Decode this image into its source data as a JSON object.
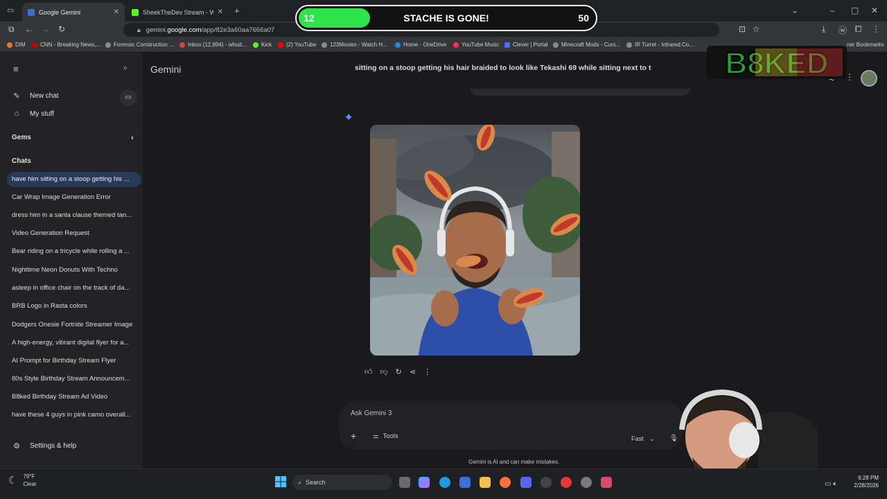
{
  "browser": {
    "tabs": [
      {
        "label": "Google Gemini",
        "active": true
      },
      {
        "label": "SheekTheDev Stream - Watch L",
        "active": false
      }
    ],
    "url_prefix": "gemini.",
    "url_host": "google.com",
    "url_path": "/app/82e3a60aa7666a07",
    "bookmarks": [
      "DIM",
      "CNN - Breaking News,...",
      "Forensic Construction ...",
      "Inbox (12,894) - whud...",
      "Kick",
      "(2) YouTube",
      "123Movies - Watch H...",
      "Home - OneDrive",
      "YouTube Music",
      "Clever | Portal",
      "Minecraft Mods - Curs...",
      "IR Turret - Infrared Co...",
      "ner Bookmarks"
    ]
  },
  "overlay": {
    "goal_current": "12",
    "goal_title": "STACHE IS GONE!",
    "goal_max": "50",
    "goal_progress": 0.24,
    "logo_text": "B8KED"
  },
  "sidebar": {
    "new_chat": "New chat",
    "my_stuff": "My stuff",
    "gems": "Gems",
    "chats_heading": "Chats",
    "chats": [
      "have him sitting on a stoop getting his ...",
      "Car Wrap Image Generation Error",
      "dress him in a santa clause themed tan...",
      "Video Generation Request",
      "Bear riding on a tricycle while rolling a ...",
      "Nighttime Neon Donuts With Techno",
      "asleep in office chair on the track of da...",
      "BRB Logo in Rasta colors",
      "Dodgers Onesie Fortnite Streamer Image",
      "A high-energy, vibrant digital flyer for a...",
      "AI Prompt for Birthday Stream Flyer",
      "80s Style Birthday Stream Announcem...",
      "B8ked Birthday Stream Ad Video",
      "have these 4 guys in pink camo overall..."
    ],
    "settings": "Settings & help"
  },
  "main": {
    "title": "Gemini",
    "prompt_text": "sitting on a stoop getting his hair braided to look like Tekashi 69 while sitting next to t",
    "composer_placeholder": "Ask Gemini 3",
    "tools_label": "Tools",
    "mode_label": "Fast",
    "disclaimer": "Gemini is AI and can make mistakes."
  },
  "taskbar": {
    "temp": "79°F",
    "condition": "Clear",
    "search": "Search",
    "time": "6:28 PM",
    "date": "2/28/2026"
  },
  "colors": {
    "accent": "#5b8ef5",
    "selected_chat": "#283a5a",
    "goal_fill": "#2ee44a"
  }
}
